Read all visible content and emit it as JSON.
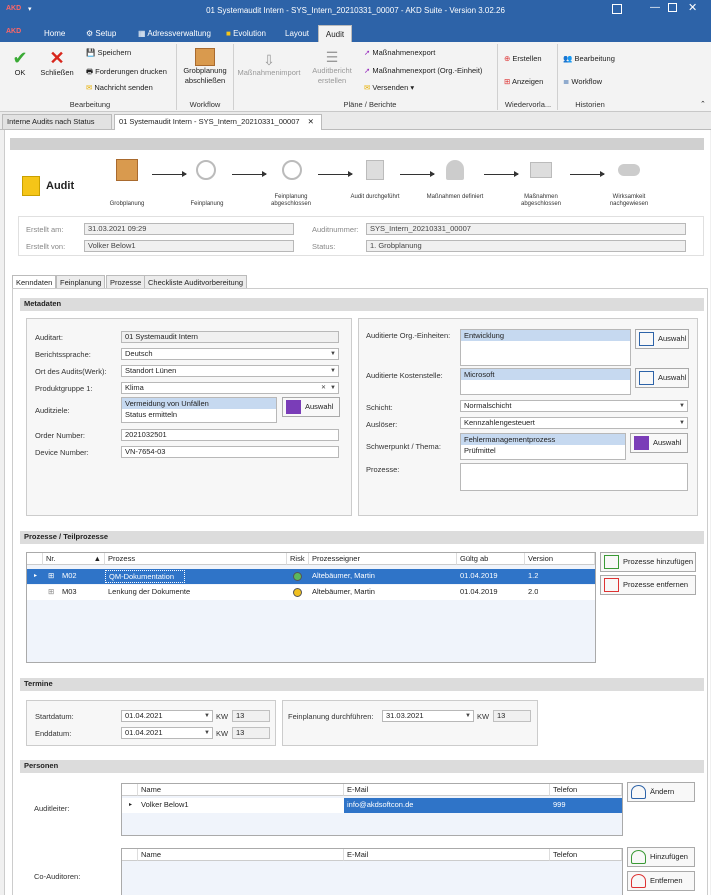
{
  "window": {
    "title": "01 Systemaudit Intern - SYS_Intern_20210331_00007 - AKD Suite - Version 3.02.26",
    "logo": "AKD"
  },
  "menu": {
    "tabs": [
      "Home",
      "Setup",
      "Adressverwaltung",
      "Evolution",
      "Layout",
      "Audit"
    ],
    "active": "Audit"
  },
  "ribbon": {
    "ok": "OK",
    "close": "Schließen",
    "save": "Speichern",
    "print": "Forderungen drucken",
    "send": "Nachricht senden",
    "group_edit": "Bearbeitung",
    "finish": "Grobplanung abschließen",
    "group_workflow": "Workflow",
    "measures_import": "Maßnahmenimport",
    "audit_report": "Auditbericht erstellen",
    "measures_export": "Maßnahmenexport",
    "measures_export_org": "Maßnahmenexport (Org.-Einheit)",
    "dispatch": "Versenden",
    "group_plans": "Pläne / Berichte",
    "create": "Erstellen",
    "show": "Anzeigen",
    "group_templates": "Wiedervorla...",
    "edit": "Bearbeitung",
    "workflow": "Workflow",
    "group_history": "Historien"
  },
  "doctabs": [
    "Interne Audits nach Status",
    "01 Systemaudit Intern - SYS_Intern_20210331_00007"
  ],
  "header": {
    "title": "Audit"
  },
  "workflow_steps": [
    "Grobplanung",
    "Feinplanung",
    "Feinplanung abgeschlossen",
    "Audit durchgeführt",
    "Maßnahmen definiert",
    "Maßnahmen abgeschlossen",
    "Wirksamkeit nachgewiesen"
  ],
  "info": {
    "created_at_label": "Erstellt am:",
    "created_at": "31.03.2021 09:29",
    "created_by_label": "Erstellt von:",
    "created_by": "Volker Below1",
    "audit_no_label": "Auditnummer:",
    "audit_no": "SYS_Intern_20210331_00007",
    "status_label": "Status:",
    "status": "1. Grobplanung"
  },
  "formtabs": [
    "Kenndaten",
    "Feinplanung",
    "Prozesse",
    "Checkliste Auditvorbereitung"
  ],
  "metadata": {
    "section": "Metadaten",
    "auditart_label": "Auditart:",
    "auditart": "01 Systemaudit Intern",
    "lang_label": "Berichtssprache:",
    "lang": "Deutsch",
    "site_label": "Ort des Audits(Werk):",
    "site": "Standort Lünen",
    "group_label": "Produktgruppe 1:",
    "group": "Klima",
    "goals_label": "Auditziele:",
    "goals": [
      "Vermeidung von Unfällen",
      "Status ermitteln"
    ],
    "order_label": "Order Number:",
    "order": "2021032501",
    "device_label": "Device Number:",
    "device": "VN-7654-03",
    "org_label": "Auditierte Org.-Einheiten:",
    "org": "Entwicklung",
    "cost_label": "Auditierte Kostenstelle:",
    "cost": "Microsoft",
    "shift_label": "Schicht:",
    "shift": "Normalschicht",
    "trigger_label": "Auslöser:",
    "trigger": "Kennzahlengesteuert",
    "focus_label": "Schwerpunkt / Thema:",
    "focus": [
      "Fehlermanagementprozess",
      "Prüfmittel"
    ],
    "processes_label": "Prozesse:",
    "select_btn": "Auswahl"
  },
  "processes": {
    "section": "Prozesse / Teilprozesse",
    "columns": [
      "Nr.",
      "Prozess",
      "Risk",
      "Prozesseigner",
      "Gültg ab",
      "Version"
    ],
    "rows": [
      {
        "nr": "M02",
        "name": "QM-Dokumentation",
        "risk": "#5cb85c",
        "owner": "Altebäumer, Martin",
        "valid": "01.04.2019",
        "version": "1.2"
      },
      {
        "nr": "M03",
        "name": "Lenkung der Dokumente",
        "risk": "#f0c020",
        "owner": "Altebäumer, Martin",
        "valid": "01.04.2019",
        "version": "2.0"
      }
    ],
    "add_btn": "Prozesse hinzufügen",
    "remove_btn": "Prozesse entfernen"
  },
  "dates": {
    "section": "Termine",
    "start_label": "Startdatum:",
    "start": "01.04.2021",
    "start_kw": "13",
    "end_label": "Enddatum:",
    "end": "01.04.2021",
    "end_kw": "13",
    "kw_label": "KW",
    "fine_label": "Feinplanung durchführen:",
    "fine": "31.03.2021",
    "fine_kw": "13"
  },
  "persons": {
    "section": "Personen",
    "lead_label": "Auditleiter:",
    "co_label": "Co-Auditoren:",
    "columns": [
      "Name",
      "E-Mail",
      "Telefon"
    ],
    "lead_row": {
      "name": "Volker Below1",
      "email": "info@akdsoftcon.de",
      "phone": "999"
    },
    "change_btn": "Ändern",
    "add_btn": "Hinzufügen",
    "remove_btn": "Entfernen"
  }
}
